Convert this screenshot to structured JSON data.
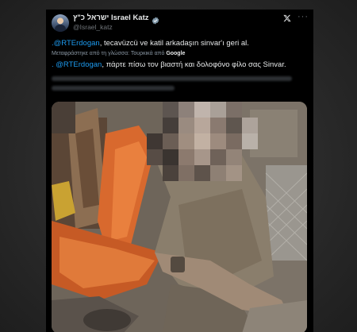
{
  "tweet": {
    "display_name": "ישראל כ\"ץ Israel Katz",
    "handle": "@Israel_katz",
    "more_label": "···",
    "text_mention": ".@RTErdogan",
    "text_body": ", tecavüzcü ve katil arkadaşın sinvar'ı geri al.",
    "translated_label": "Μεταφράστηκε από τη γλώσσα: Τουρκικά από",
    "translated_by": "Google",
    "greek_mention": ". @RTErdogan",
    "greek_body": ", πάρτε πίσω τον βιαστή και δολοφόνο φίλο σας Sinvar.",
    "icons": [
      "verified-badge-icon",
      "x-logo-icon",
      "more-options-icon"
    ],
    "colors": {
      "link": "#1d9bf0",
      "text": "#e7e9ea",
      "muted": "#71767b",
      "background": "#000000"
    }
  },
  "media": {
    "type": "photo",
    "censored": true
  }
}
